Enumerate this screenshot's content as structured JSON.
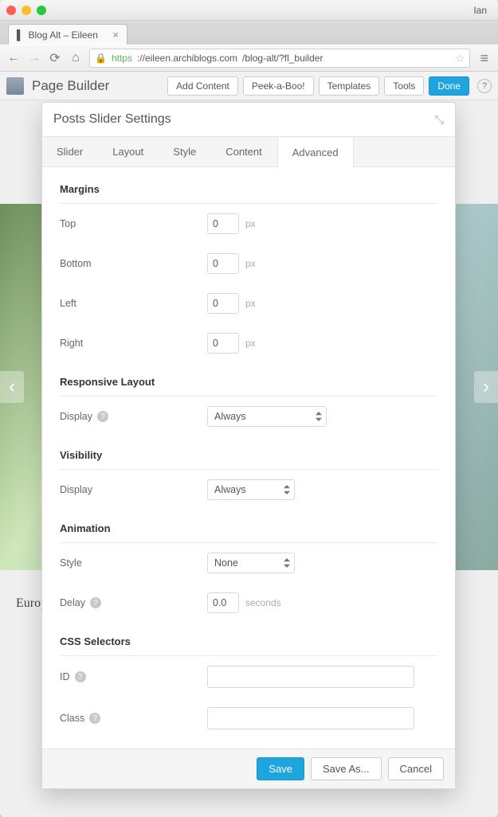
{
  "browser": {
    "user": "Ian",
    "tab_title": "Blog Alt – Eileen",
    "url_https": "https",
    "url_host": "://eileen.archiblogs.com",
    "url_path": "/blog-alt/?fl_builder"
  },
  "pagebuilder": {
    "title": "Page Builder",
    "add_content": "Add Content",
    "peek": "Peek-a-Boo!",
    "templates": "Templates",
    "tools": "Tools",
    "done": "Done"
  },
  "modal": {
    "title": "Posts Slider Settings",
    "tabs": {
      "slider": "Slider",
      "layout": "Layout",
      "style": "Style",
      "content": "Content",
      "advanced": "Advanced"
    },
    "sections": {
      "margins": "Margins",
      "responsive": "Responsive Layout",
      "visibility": "Visibility",
      "animation": "Animation",
      "css": "CSS Selectors"
    },
    "labels": {
      "top": "Top",
      "bottom": "Bottom",
      "left": "Left",
      "right": "Right",
      "display": "Display",
      "style": "Style",
      "delay": "Delay",
      "id": "ID",
      "class": "Class"
    },
    "values": {
      "margin_top": "0",
      "margin_bottom": "0",
      "margin_left": "0",
      "margin_right": "0",
      "responsive_display": "Always",
      "visibility_display": "Always",
      "anim_style": "None",
      "anim_delay": "0.0",
      "id": "",
      "class": ""
    },
    "units": {
      "px": "px",
      "seconds": "seconds"
    },
    "footer": {
      "save": "Save",
      "save_as": "Save As...",
      "cancel": "Cancel"
    }
  },
  "article": {
    "text": "Europe and beyond as we search and scour the weird and wonderful for great new"
  }
}
